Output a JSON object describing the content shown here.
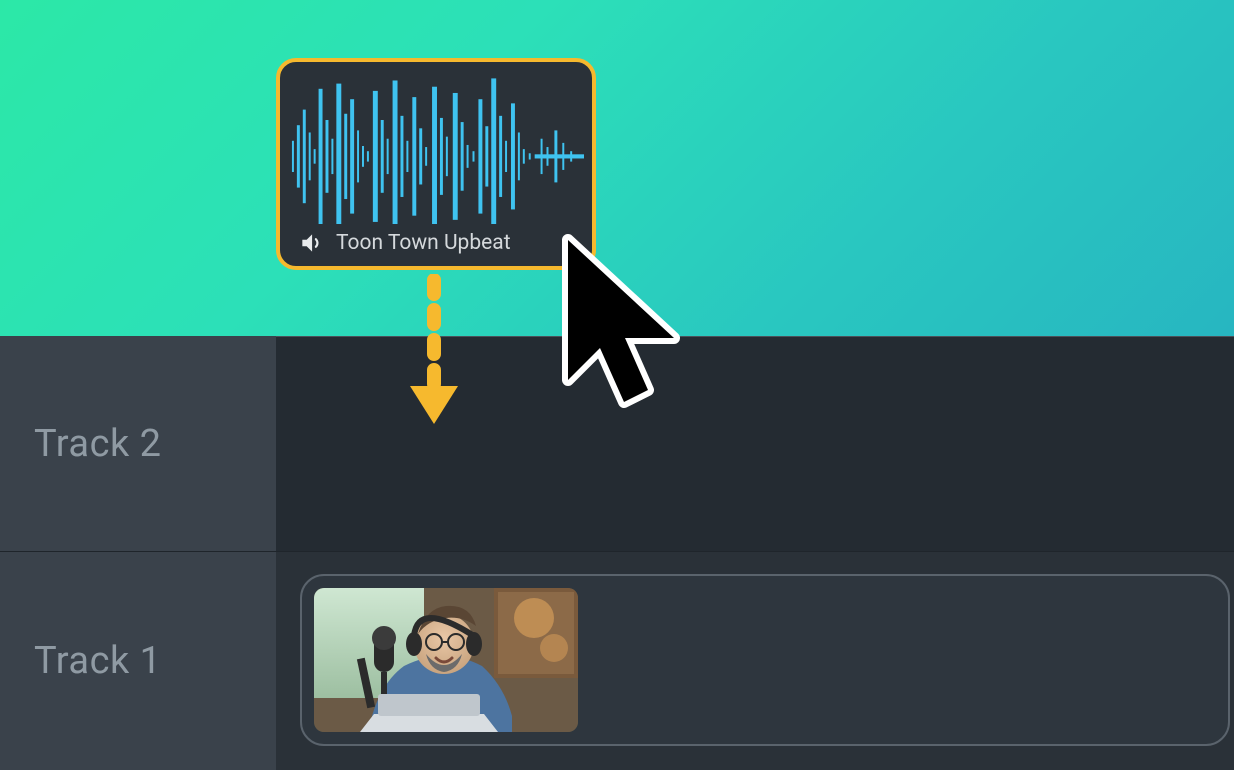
{
  "tracks": {
    "track2_label": "Track 2",
    "track1_label": "Track 1"
  },
  "audio_clip": {
    "name": "Toon Town Upbeat"
  },
  "colors": {
    "accent_border": "#f6b92e",
    "waveform": "#3fc3f0"
  }
}
